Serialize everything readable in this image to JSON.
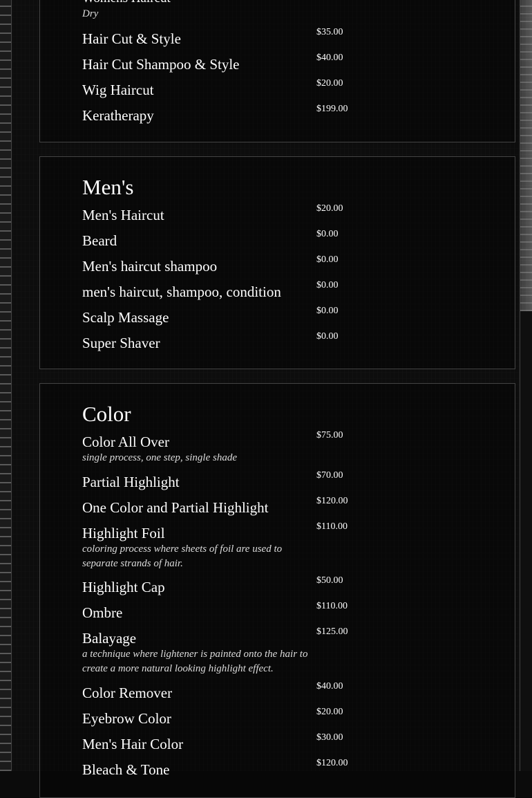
{
  "womens": {
    "title": "Womens Haircut",
    "title_note": "Dry",
    "items": [
      {
        "name": "Hair Cut & Style",
        "price": "$35.00"
      },
      {
        "name": "Hair Cut Shampoo & Style",
        "price": "$40.00"
      },
      {
        "name": "Wig Haircut",
        "price": "$20.00"
      },
      {
        "name": "Keratherapy",
        "price": "$199.00"
      }
    ]
  },
  "mens": {
    "title": "Men's",
    "items": [
      {
        "name": "Men's Haircut",
        "price": "$20.00"
      },
      {
        "name": "Beard",
        "price": "$0.00"
      },
      {
        "name": "Men's haircut shampoo",
        "price": "$0.00"
      },
      {
        "name": "men's haircut, shampoo, condition",
        "price": "$0.00"
      },
      {
        "name": "Scalp Massage",
        "price": "$0.00"
      },
      {
        "name": "Super Shaver",
        "price": "$0.00"
      }
    ]
  },
  "color": {
    "title": "Color",
    "items": [
      {
        "name": "Color All Over",
        "desc": "single process, one step, single shade",
        "price": "$75.00"
      },
      {
        "name": "Partial Highlight",
        "price": "$70.00"
      },
      {
        "name": "One Color and Partial Highlight",
        "price": "$120.00"
      },
      {
        "name": "Highlight Foil",
        "desc": "coloring process where sheets of foil are used to separate strands of hair.",
        "price": "$110.00"
      },
      {
        "name": "Highlight Cap",
        "price": "$50.00"
      },
      {
        "name": "Ombre",
        "price": "$110.00"
      },
      {
        "name": "Balayage",
        "desc": "a technique where lightener is painted onto the hair to create a more natural looking highlight effect.",
        "price": "$125.00"
      },
      {
        "name": "Color Remover",
        "price": "$40.00"
      },
      {
        "name": "Eyebrow Color",
        "price": "$20.00"
      },
      {
        "name": "Men's Hair Color",
        "price": "$30.00"
      },
      {
        "name": "Bleach & Tone",
        "price": "$120.00"
      }
    ]
  }
}
